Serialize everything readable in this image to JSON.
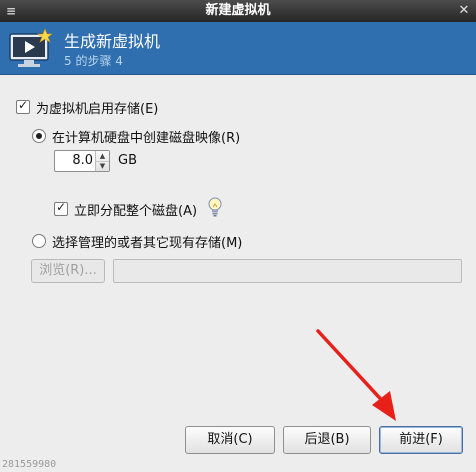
{
  "window": {
    "title": "新建虚拟机"
  },
  "titlebar_icons": {
    "left": "window-menu-icon",
    "right": "close-icon"
  },
  "banner": {
    "title": "生成新虚拟机",
    "step": "5 的步骤 4",
    "icon": "monitor-play-icon"
  },
  "storage": {
    "enable_label": "为虚拟机启用存储(E)",
    "enable_checked": true,
    "create_option_label": "在计算机硬盘中创建磁盘映像(R)",
    "create_selected": true,
    "size_value": "8.0",
    "size_unit": "GB",
    "allocate_label": "立即分配整个磁盘(A)",
    "allocate_checked": true,
    "existing_option_label": "选择管理的或者其它现有存储(M)",
    "existing_selected": false,
    "browse_label": "浏览(R)...",
    "path_value": ""
  },
  "buttons": {
    "cancel": "取消(C)",
    "back": "后退(B)",
    "forward": "前进(F)"
  },
  "watermark": "281559980",
  "colors": {
    "banner": "#2f6fb0",
    "arrow": "#e8201a"
  }
}
